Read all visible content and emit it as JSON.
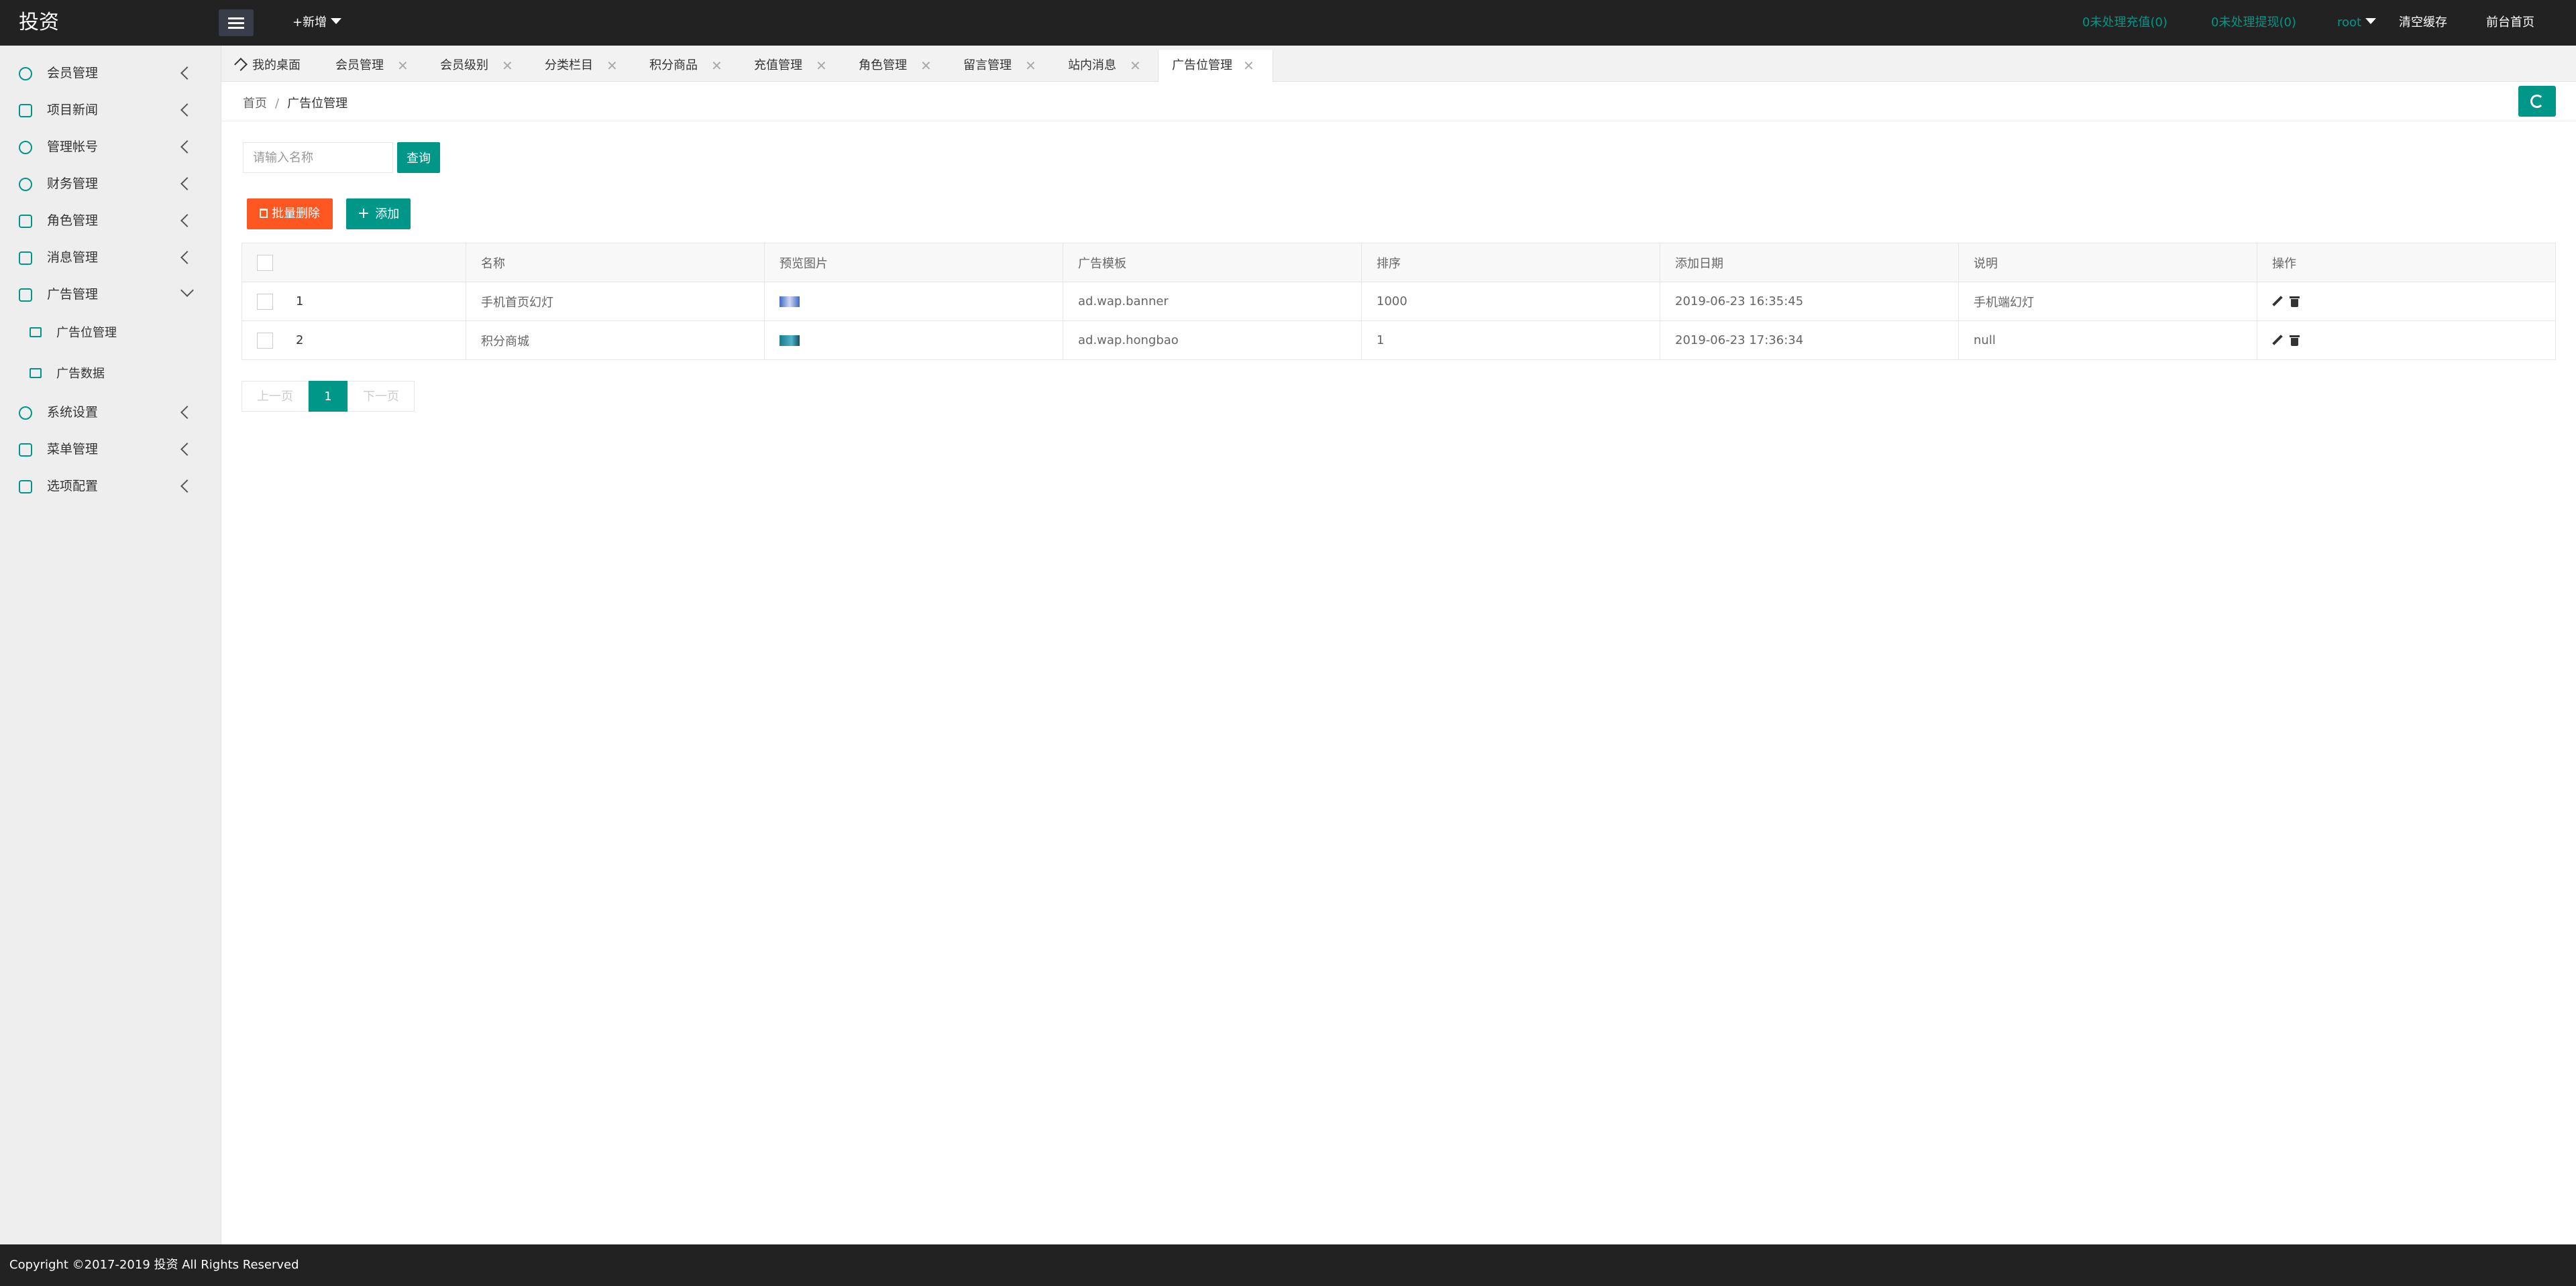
{
  "app": {
    "title": "投资"
  },
  "header": {
    "add_label": "+新增",
    "pending_recharge": "0未处理充值(0)",
    "pending_withdraw": "0未处理提现(0)",
    "user": "root",
    "clear_cache": "清空缓存",
    "front_home": "前台首页"
  },
  "sidebar": {
    "items": [
      {
        "label": "会员管理",
        "icon": "user-icon"
      },
      {
        "label": "项目新闻",
        "icon": "book-icon"
      },
      {
        "label": "管理帐号",
        "icon": "account-icon"
      },
      {
        "label": "财务管理",
        "icon": "finance-icon"
      },
      {
        "label": "角色管理",
        "icon": "shield-icon"
      },
      {
        "label": "消息管理",
        "icon": "message-icon"
      },
      {
        "label": "广告管理",
        "icon": "image-icon",
        "expanded": true
      },
      {
        "label": "系统设置",
        "icon": "gear-icon"
      },
      {
        "label": "菜单管理",
        "icon": "menu-icon"
      },
      {
        "label": "选项配置",
        "icon": "config-icon"
      }
    ],
    "subitems": [
      {
        "label": "广告位管理",
        "icon": "image-icon"
      },
      {
        "label": "广告数据",
        "icon": "image-icon"
      }
    ]
  },
  "tabs": [
    {
      "label": "我的桌面",
      "closable": false
    },
    {
      "label": "会员管理",
      "closable": true
    },
    {
      "label": "会员级别",
      "closable": true
    },
    {
      "label": "分类栏目",
      "closable": true
    },
    {
      "label": "积分商品",
      "closable": true
    },
    {
      "label": "充值管理",
      "closable": true
    },
    {
      "label": "角色管理",
      "closable": true
    },
    {
      "label": "留言管理",
      "closable": true
    },
    {
      "label": "站内消息",
      "closable": true
    },
    {
      "label": "广告位管理",
      "closable": true,
      "active": true
    }
  ],
  "tab_close_glyph": "✕",
  "breadcrumb": {
    "home": "首页",
    "sep": "/",
    "current": "广告位管理"
  },
  "search": {
    "placeholder": "请输入名称",
    "button": "查询"
  },
  "actions": {
    "batch_delete": "批量删除",
    "add": "添加"
  },
  "table": {
    "columns": [
      "名称",
      "预览图片",
      "广告模板",
      "排序",
      "添加日期",
      "说明",
      "操作"
    ],
    "rows": [
      {
        "id": "1",
        "name": "手机首页幻灯",
        "template": "ad.wap.banner",
        "sort": "1000",
        "date": "2019-06-23 16:35:45",
        "desc": "手机端幻灯"
      },
      {
        "id": "2",
        "name": "积分商城",
        "template": "ad.wap.hongbao",
        "sort": "1",
        "date": "2019-06-23 17:36:34",
        "desc": "null"
      }
    ]
  },
  "pager": {
    "prev": "上一页",
    "current": "1",
    "next": "下一页"
  },
  "footer": {
    "copyright": "Copyright ©2017-2019 投资 All Rights Reserved"
  },
  "colors": {
    "accent": "#009688",
    "danger": "#ff5722",
    "header_bg": "#222222"
  }
}
